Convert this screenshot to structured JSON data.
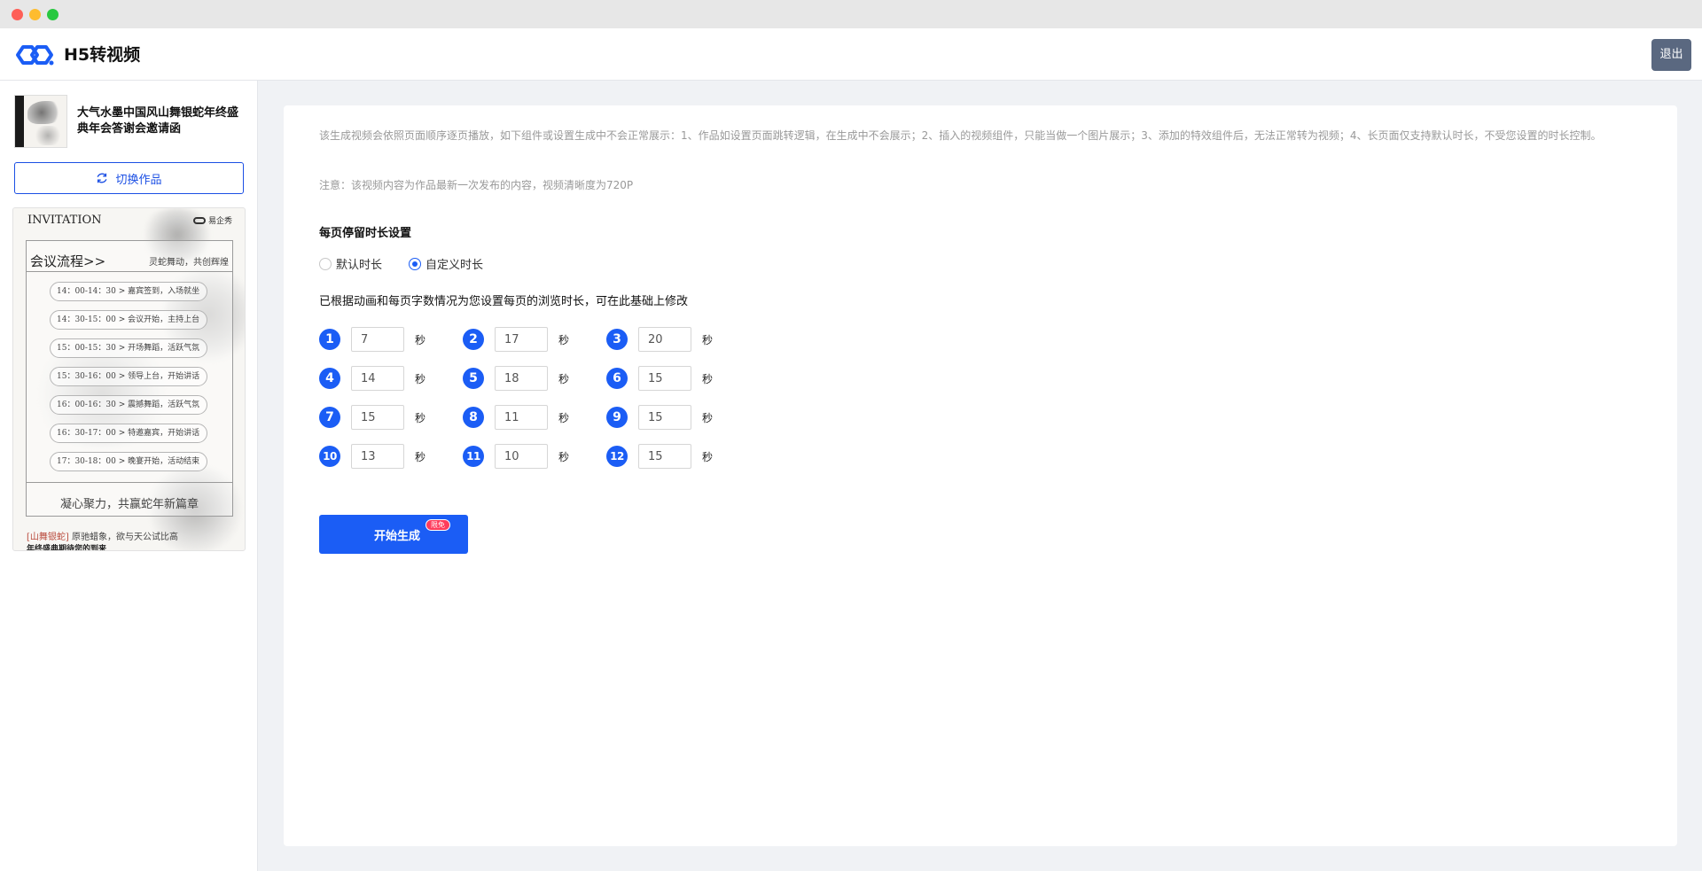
{
  "app": {
    "title": "H5转视频",
    "logout_label": "退出"
  },
  "sidebar": {
    "work_title": "大气水墨中国风山舞银蛇年终盛典年会答谢会邀请函",
    "switch_label": "切换作品",
    "preview": {
      "heading": "INVITATION",
      "brand": "易企秀",
      "frame_title": "会议流程>>",
      "frame_subtitle": "灵蛇舞动，共创辉煌",
      "schedule": [
        "14：00-14：30 > 嘉宾签到，入场就坐",
        "14：30-15：00 > 会议开始，主持上台",
        "15：00-15：30 > 开场舞蹈，活跃气氛",
        "15：30-16：00 > 领导上台，开始讲话",
        "16：00-16：30 > 震撼舞蹈，活跃气氛",
        "16：30-17：00 > 特邀嘉宾，开始讲话",
        "17：30-18：00 > 晚宴开始，活动结束"
      ],
      "footer": "凝心聚力，共赢蛇年新篇章",
      "note_red": "[山舞银蛇]",
      "note_rest": " 原驰蜡象，欲与天公试比高",
      "note_bold": "年终盛典期待您的到来"
    }
  },
  "main": {
    "description": "该生成视频会依照页面顺序逐页播放，如下组件或设置生成中不会正常展示：1、作品如设置页面跳转逻辑，在生成中不会展示；2、插入的视频组件，只能当做一个图片展示；3、添加的特效组件后，无法正常转为视频；4、长页面仅支持默认时长，不受您设置的时长控制。",
    "note": "注意：该视频内容为作品最新一次发布的内容，视频清晰度为720P",
    "section_title": "每页停留时长设置",
    "radio_options": [
      {
        "label": "默认时长",
        "checked": false
      },
      {
        "label": "自定义时长",
        "checked": true
      }
    ],
    "section_desc": "已根据动画和每页字数情况为您设置每页的浏览时长，可在此基础上修改",
    "unit": "秒",
    "pages": [
      {
        "num": "1",
        "value": "7"
      },
      {
        "num": "2",
        "value": "17"
      },
      {
        "num": "3",
        "value": "20"
      },
      {
        "num": "4",
        "value": "14"
      },
      {
        "num": "5",
        "value": "18"
      },
      {
        "num": "6",
        "value": "15"
      },
      {
        "num": "7",
        "value": "15"
      },
      {
        "num": "8",
        "value": "11"
      },
      {
        "num": "9",
        "value": "15"
      },
      {
        "num": "10",
        "value": "13"
      },
      {
        "num": "11",
        "value": "10"
      },
      {
        "num": "12",
        "value": "15"
      }
    ],
    "generate_label": "开始生成",
    "generate_badge": "限免"
  },
  "colors": {
    "accent": "#1b5df5",
    "logout_bg": "#5a6880",
    "badge": "#ff3b5c"
  }
}
